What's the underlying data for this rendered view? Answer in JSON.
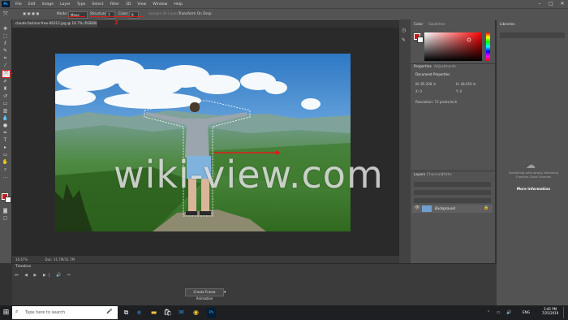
{
  "menubar": {
    "logo": "Ps",
    "items": [
      "File",
      "Edit",
      "Image",
      "Layer",
      "Type",
      "Select",
      "Filter",
      "3D",
      "View",
      "Window",
      "Help"
    ]
  },
  "options": {
    "mode_label": "Mode:",
    "mode_value": "Move",
    "structure_label": "Structure:",
    "structure_value": "7",
    "color_label": "Color:",
    "color_value": "9",
    "sample_label": "Sample All Layers",
    "transform_label": "Transform On Drop"
  },
  "annotations": {
    "mark_2": "2",
    "mark_1": "1"
  },
  "document": {
    "tab_title": "clouds-fashion-free-06312.jpg @ 16.7% (RGB/8)",
    "zoom": "16.67%",
    "doc_size": "Doc: 31.7M/31.7M"
  },
  "watermark": "wiki-view.com",
  "panels": {
    "color_tab": "Color",
    "swatches_tab": "Swatches",
    "properties_tab": "Properties",
    "adjustments_tab": "Adjustments",
    "doc_props": "Document Properties",
    "w": "W: 85.208 in",
    "h": "H: 48.056 in",
    "x": "X: 0",
    "y": "Y: 0",
    "resolution": "Resolution: 72 pixels/inch",
    "layers_tab": "Layers",
    "channels_tab": "Channels",
    "paths_tab": "Paths",
    "layer_name": "Background",
    "libraries_tab": "Libraries",
    "lib_message": "Something went wrong initializing Creative Cloud Libraries",
    "lib_link": "More Information"
  },
  "timeline": {
    "title": "Timeline",
    "create_button": "Create Frame Animation"
  },
  "taskbar": {
    "search_placeholder": "Type here to search",
    "lang": "ENG",
    "time": "3:45 PM",
    "date": "7/25/2019"
  },
  "colors": {
    "foreground": "#c41f1f",
    "background": "#ffffff",
    "annotation_red": "#e01b1b"
  }
}
